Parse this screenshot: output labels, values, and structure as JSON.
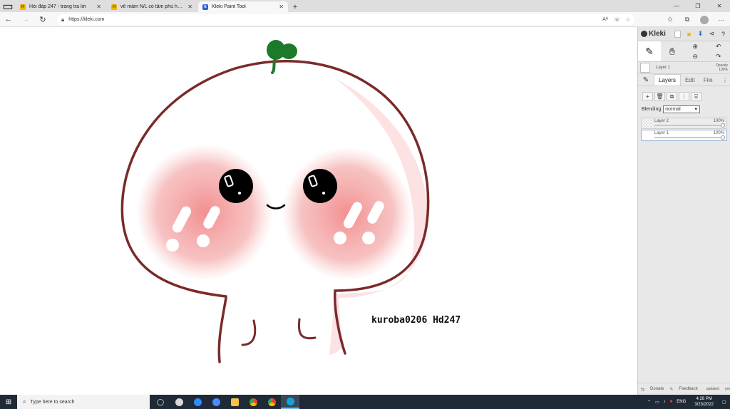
{
  "browser": {
    "tabs": [
      {
        "title": "Hỏi đáp 247 - trang tra lời",
        "favicon": "hoidap-favicon",
        "active": false
      },
      {
        "title": "vẽ mầm N/L có tâm phù hợp với ...",
        "favicon": "hoidap-favicon",
        "active": false
      },
      {
        "title": "Kleki Paint Tool",
        "favicon": "kleki-favicon",
        "active": true
      }
    ],
    "url": "https://kleki.com",
    "read_aloud_label": "Aᴬ"
  },
  "artwork": {
    "signature": "kuroba0206 Hd247",
    "colors": {
      "outline": "#7a2a2a",
      "sprout": "#1c7a2a",
      "blush": "#f08a8a",
      "shade": "#fde2e4",
      "eye": "#000000"
    }
  },
  "kleki": {
    "logo": "Kleki",
    "current_layer": "Layer 1",
    "opacity_label": "Opacity",
    "opacity_value": "100%",
    "tabs": [
      "Layers",
      "Edit",
      "File"
    ],
    "active_tab": "Layers",
    "blending_label": "Blending",
    "blending_value": "normal",
    "layers": [
      {
        "name": "Layer 2",
        "opacity": "100%",
        "selected": false
      },
      {
        "name": "Layer 1",
        "opacity": "100%",
        "selected": true
      }
    ],
    "footer": {
      "donate": "Donate",
      "feedback": "Feedback",
      "updated": "updated",
      "updated_when": "yesterday"
    }
  },
  "taskbar": {
    "search_placeholder": "Type here to search",
    "language": "ENG",
    "time": "4:28 PM",
    "date": "3/23/2022"
  }
}
